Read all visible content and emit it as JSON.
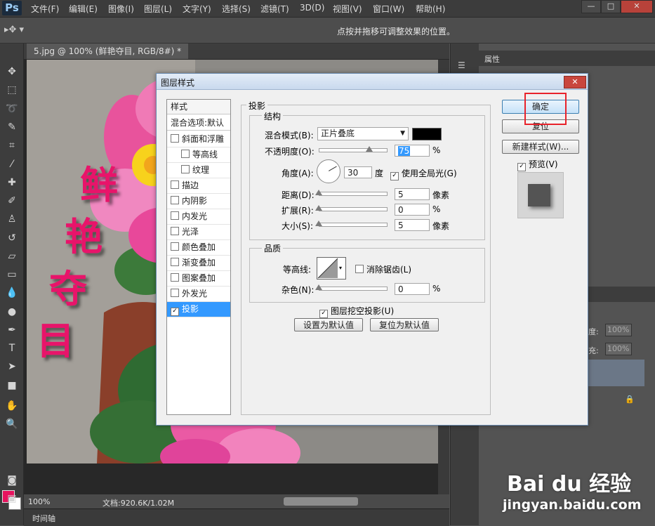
{
  "app": {
    "logo": "Ps",
    "menu": [
      "文件(F)",
      "编辑(E)",
      "图像(I)",
      "图层(L)",
      "文字(Y)",
      "选择(S)",
      "滤镜(T)",
      "3D(D)",
      "视图(V)",
      "窗口(W)",
      "帮助(H)"
    ],
    "window_controls": {
      "minimize": "—",
      "restore": "□",
      "close": "✕"
    }
  },
  "options_bar": {
    "hint": "点按并拖移可调整效果的位置。"
  },
  "document": {
    "tab_title": "5.jpg @ 100% (鲜艳夺目, RGB/8#) *",
    "canvas_text": [
      "鲜",
      "艳",
      "夺",
      "目"
    ],
    "status_zoom": "100%",
    "status_doc": "文档:920.6K/1.02M",
    "timeline_label": "时间轴"
  },
  "right_panel": {
    "properties_tab": "属性",
    "opacity_label": "度:",
    "opacity_value": "100%",
    "fill_label": "充:",
    "fill_value": "100%"
  },
  "dialog": {
    "title": "图层样式",
    "close": "✕",
    "styles_header": "样式",
    "blend_options": "混合选项:默认",
    "styles": [
      {
        "label": "斜面和浮雕",
        "checked": false,
        "indent": false,
        "selected": false
      },
      {
        "label": "等高线",
        "checked": false,
        "indent": true,
        "selected": false
      },
      {
        "label": "纹理",
        "checked": false,
        "indent": true,
        "selected": false
      },
      {
        "label": "描边",
        "checked": false,
        "indent": false,
        "selected": false
      },
      {
        "label": "内阴影",
        "checked": false,
        "indent": false,
        "selected": false
      },
      {
        "label": "内发光",
        "checked": false,
        "indent": false,
        "selected": false
      },
      {
        "label": "光泽",
        "checked": false,
        "indent": false,
        "selected": false
      },
      {
        "label": "颜色叠加",
        "checked": false,
        "indent": false,
        "selected": false
      },
      {
        "label": "渐变叠加",
        "checked": false,
        "indent": false,
        "selected": false
      },
      {
        "label": "图案叠加",
        "checked": false,
        "indent": false,
        "selected": false
      },
      {
        "label": "外发光",
        "checked": false,
        "indent": false,
        "selected": false
      },
      {
        "label": "投影",
        "checked": true,
        "indent": false,
        "selected": true
      }
    ],
    "section_title": "投影",
    "structure": {
      "title": "结构",
      "blend_mode_label": "混合模式(B):",
      "blend_mode_value": "正片叠底",
      "shadow_color": "#000000",
      "opacity_label": "不透明度(O):",
      "opacity_value": "75",
      "opacity_unit": "%",
      "angle_label": "角度(A):",
      "angle_value": "30",
      "angle_unit": "度",
      "global_light_label": "使用全局光(G)",
      "global_light_checked": true,
      "distance_label": "距离(D):",
      "distance_value": "5",
      "distance_unit": "像素",
      "spread_label": "扩展(R):",
      "spread_value": "0",
      "spread_unit": "%",
      "size_label": "大小(S):",
      "size_value": "5",
      "size_unit": "像素"
    },
    "quality": {
      "title": "品质",
      "contour_label": "等高线:",
      "antialias_label": "消除锯齿(L)",
      "antialias_checked": false,
      "noise_label": "杂色(N):",
      "noise_value": "0",
      "noise_unit": "%"
    },
    "knockout_label": "图层挖空投影(U)",
    "knockout_checked": true,
    "set_default_button": "设置为默认值",
    "reset_default_button": "复位为默认值",
    "ok_button": "确定",
    "reset_button": "复位",
    "new_style_button": "新建样式(W)...",
    "preview_label": "预览(V)",
    "preview_checked": true
  },
  "slider_levels": {
    "opacity": 0.75,
    "distance": 0.0,
    "spread": 0.0,
    "size": 0.0,
    "noise": 0.0
  },
  "watermark": {
    "main": "Bai du 经验",
    "sub": "jingyan.baidu.com"
  },
  "colors": {
    "foreground": "#e6145e",
    "background": "#ffffff",
    "highlight_box": "#e8232b",
    "canvas_text": "#e8146a"
  }
}
